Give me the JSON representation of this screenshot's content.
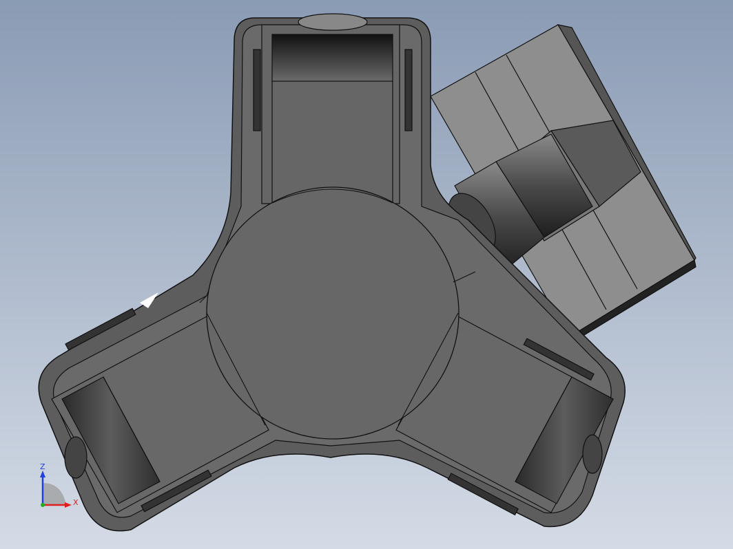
{
  "colors": {
    "background_top": "#8c9db5",
    "background_bottom": "#d3dbe6",
    "body_fill": "#686868",
    "body_dark": "#3a3a3a",
    "edge": "#111111",
    "block_fill": "#8e8e8e",
    "axis_x": "#e02020",
    "axis_y": "#20b020",
    "axis_z": "#2040e0"
  },
  "triad": {
    "z_label": "Z",
    "x_label": "X"
  }
}
